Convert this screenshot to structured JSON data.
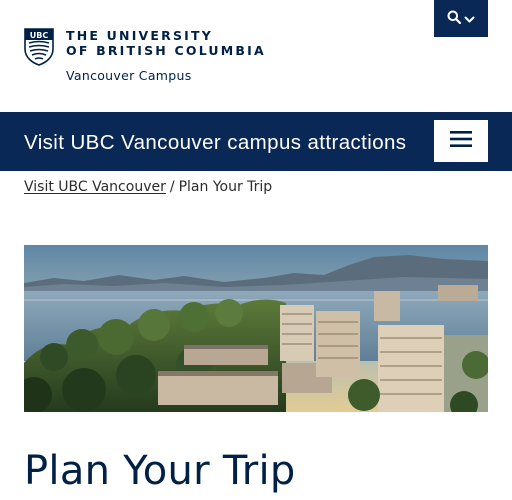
{
  "header": {
    "university_line1": "THE UNIVERSITY",
    "university_line2": "OF BRITISH COLUMBIA",
    "campus": "Vancouver Campus",
    "crest_text": "UBC",
    "crest_icon": "ubc-crest-icon",
    "search_icon": "search-icon",
    "dropdown_icon": "chevron-down-icon"
  },
  "banner": {
    "title": "Visit UBC Vancouver campus attractions",
    "menu_icon": "hamburger-menu-icon"
  },
  "breadcrumb": {
    "link": "Visit UBC Vancouver",
    "separator": "/",
    "current": "Plan Your Trip"
  },
  "page": {
    "title": "Plan Your Trip"
  },
  "colors": {
    "navy": "#002145",
    "banner_bg": "#0a2855",
    "white": "#ffffff"
  }
}
